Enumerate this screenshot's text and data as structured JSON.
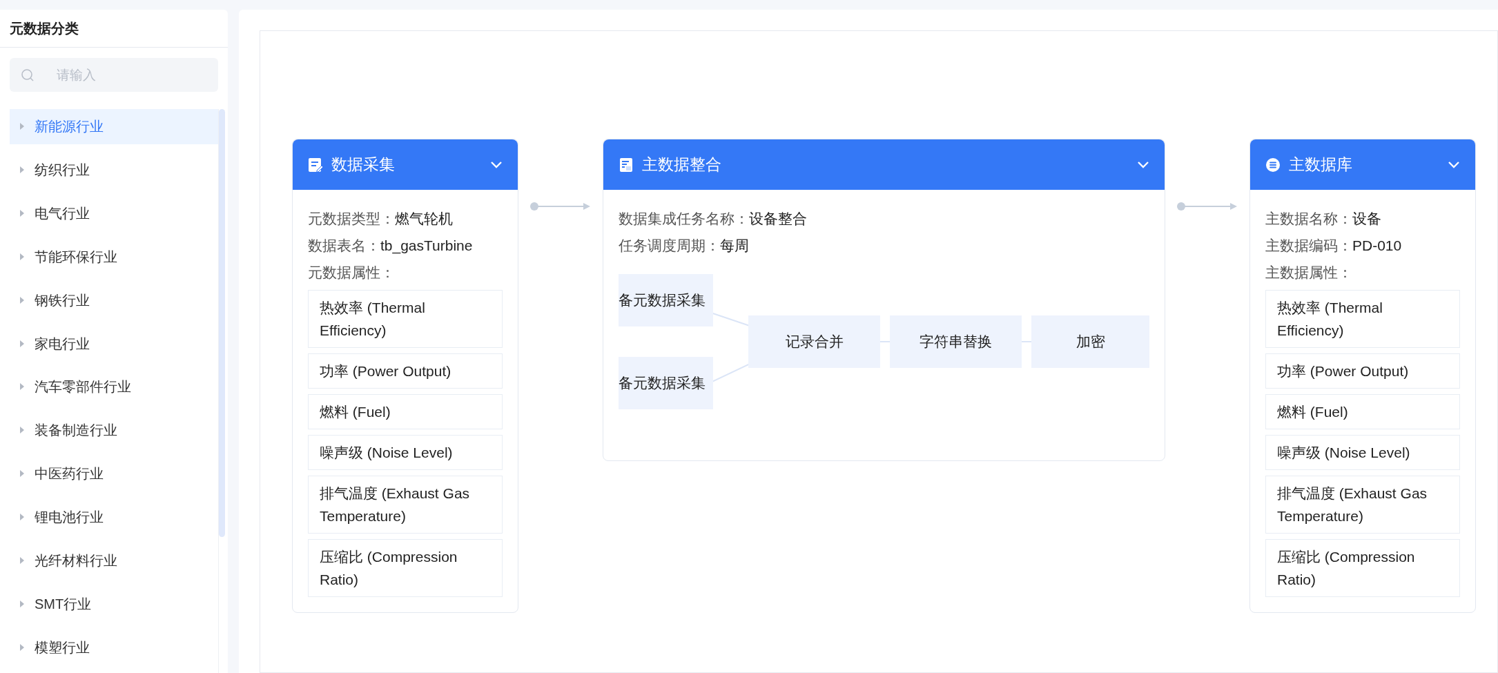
{
  "sidebar": {
    "title": "元数据分类",
    "search": {
      "placeholder": "请输入"
    },
    "items": [
      {
        "label": "新能源行业",
        "selected": true
      },
      {
        "label": "纺织行业",
        "selected": false
      },
      {
        "label": "电气行业",
        "selected": false
      },
      {
        "label": "节能环保行业",
        "selected": false
      },
      {
        "label": "钢铁行业",
        "selected": false
      },
      {
        "label": "家电行业",
        "selected": false
      },
      {
        "label": "汽车零部件行业",
        "selected": false
      },
      {
        "label": "装备制造行业",
        "selected": false
      },
      {
        "label": "中医药行业",
        "selected": false
      },
      {
        "label": "锂电池行业",
        "selected": false
      },
      {
        "label": "光纤材料行业",
        "selected": false
      },
      {
        "label": "SMT行业",
        "selected": false
      },
      {
        "label": "模塑行业",
        "selected": false
      }
    ]
  },
  "flow": {
    "cards": [
      {
        "kind": "attributes",
        "title": "数据采集",
        "fields": [
          {
            "label": "元数据类型：",
            "value": "燃气轮机"
          },
          {
            "label": "数据表名：",
            "value": "tb_gasTurbine"
          }
        ],
        "attributes_label": "元数据属性：",
        "attributes": [
          "热效率 (Thermal Efficiency)",
          "功率 (Power Output)",
          "燃料 (Fuel)",
          "噪声级 (Noise Level)",
          "排气温度 (Exhaust Gas Temperature)",
          "压缩比 (Compression Ratio)"
        ]
      },
      {
        "kind": "pipeline",
        "title": "主数据整合",
        "fields": [
          {
            "label": "数据集成任务名称：",
            "value": "设备整合"
          },
          {
            "label": "任务调度周期：",
            "value": "每周"
          }
        ],
        "sources": [
          "备元数据采集",
          "备元数据采集"
        ],
        "steps": [
          "记录合并",
          "字符串替换",
          "加密"
        ]
      },
      {
        "kind": "attributes",
        "title": "主数据库",
        "fields": [
          {
            "label": "主数据名称：",
            "value": "设备"
          },
          {
            "label": "主数据编码：",
            "value": "PD-010"
          }
        ],
        "attributes_label": "主数据属性：",
        "attributes": [
          "热效率 (Thermal Efficiency)",
          "功率 (Power Output)",
          "燃料 (Fuel)",
          "噪声级 (Noise Level)",
          "排气温度 (Exhaust Gas Temperature)",
          "压缩比 (Compression Ratio)"
        ]
      }
    ]
  }
}
